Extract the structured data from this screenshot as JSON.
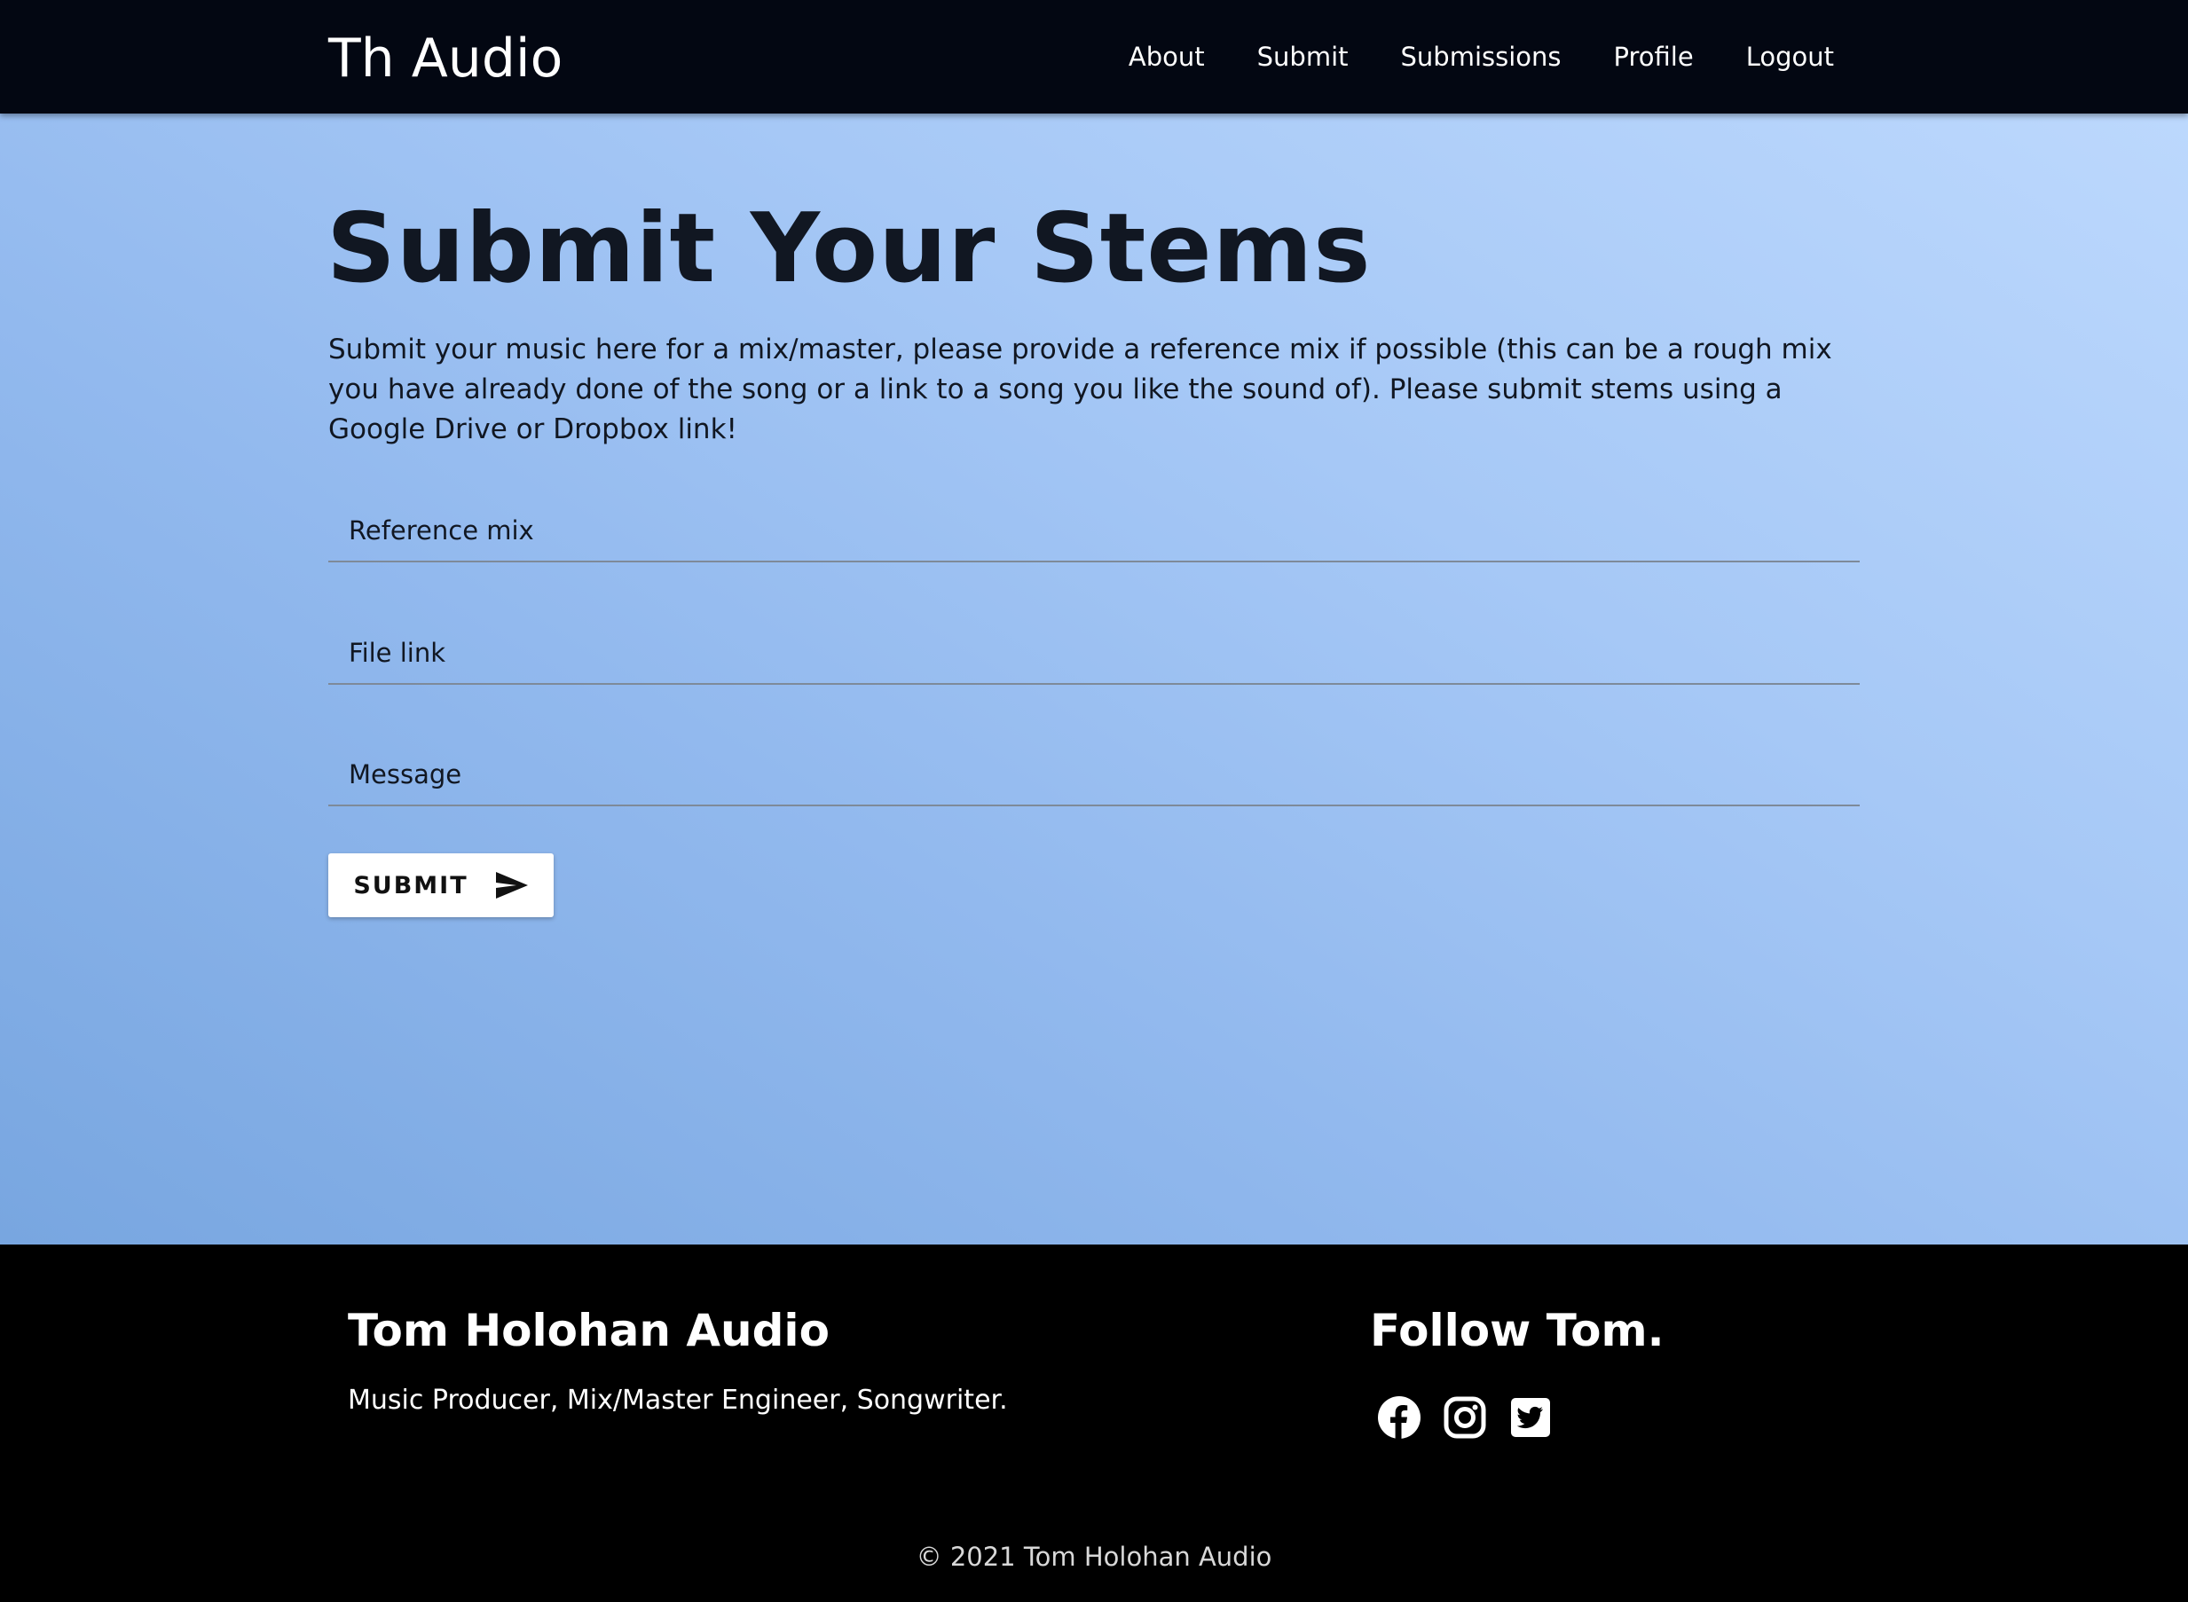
{
  "header": {
    "brand": "Th Audio",
    "nav": [
      "About",
      "Submit",
      "Submissions",
      "Profile",
      "Logout"
    ]
  },
  "main": {
    "title": "Submit Your Stems",
    "intro": "Submit your music here for a mix/master, please provide a reference mix if possible (this can be a rough mix you have already done of the song or a link to a song you like the sound of). Please submit stems using a Google Drive or Dropbox link!",
    "form": {
      "reference_placeholder": "Reference mix",
      "reference_value": "",
      "file_placeholder": "File link",
      "file_value": "",
      "message_placeholder": "Message",
      "message_value": "",
      "submit_label": "SUBMIT"
    }
  },
  "footer": {
    "title": "Tom Holohan Audio",
    "tagline": "Music Producer, Mix/Master Engineer, Songwriter.",
    "follow_title": "Follow Tom.",
    "social_icons": [
      "facebook-icon",
      "instagram-icon",
      "twitter-icon"
    ],
    "copyright": "© 2021 Tom Holohan Audio"
  },
  "colors": {
    "navbar_bg": "#030712",
    "footer_bg": "#000000",
    "gradient_start": "#78a6e0",
    "gradient_end": "#bcd8fd",
    "text_dark": "#111722",
    "button_bg": "#ffffff"
  }
}
